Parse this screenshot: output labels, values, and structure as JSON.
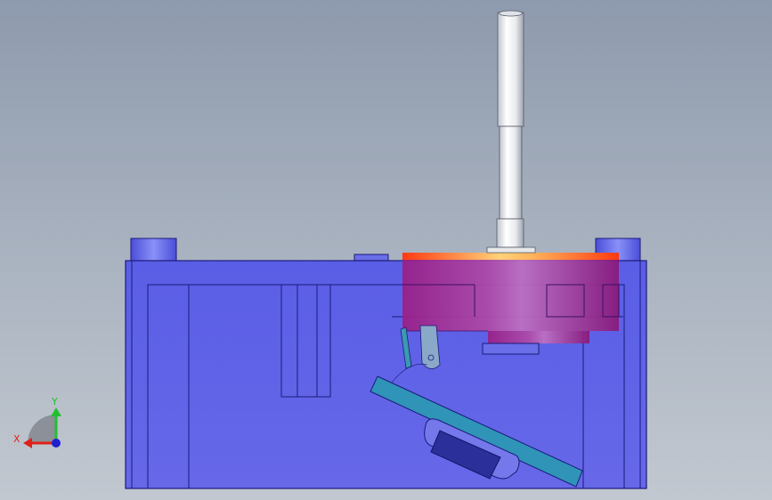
{
  "viewport": {
    "background_top": "#8e9aad",
    "background_bottom": "#c2c8d0"
  },
  "model": {
    "body_color": "#5f63e8",
    "body_edge_color": "#1a1a7a",
    "rotor_color": "#a3288c",
    "rotor_highlight_color": "#ff6a2a",
    "shaft_color": "#f2f2f2",
    "plate_color": "#2f94b8",
    "magnet_color": "#2a2f9a"
  },
  "triad": {
    "x_label": "X",
    "y_label": "Y",
    "x_color": "#e0201a",
    "y_color": "#20c030",
    "z_color": "#2020d0"
  }
}
